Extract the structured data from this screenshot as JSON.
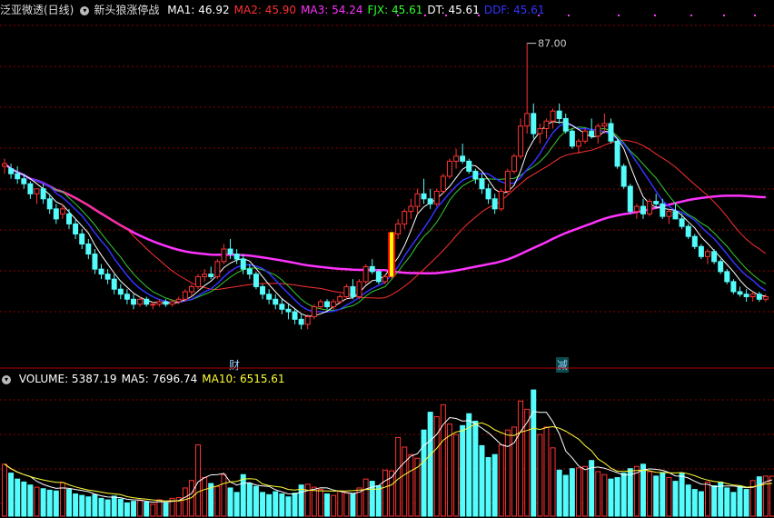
{
  "header": {
    "stock_name": "泛亚微透(日线)",
    "indicator_name": "新头狼涨停战",
    "items": [
      {
        "label": "MA1: 46.92",
        "color": "#ffffff"
      },
      {
        "label": "MA2: 45.90",
        "color": "#ff3030"
      },
      {
        "label": "MA3: 54.24",
        "color": "#ff33ff"
      },
      {
        "label": "FJX: 45.61",
        "color": "#33ff33"
      },
      {
        "label": "DT: 45.61",
        "color": "#ffffff"
      },
      {
        "label": "DDF: 45.61",
        "color": "#3333ff"
      }
    ]
  },
  "volume_header": {
    "items": [
      {
        "label": "VOLUME: 5387.19",
        "color": "#ffffff"
      },
      {
        "label": "MA5: 7696.74",
        "color": "#ffffff"
      },
      {
        "label": "MA10: 6515.61",
        "color": "#ffff33"
      }
    ]
  },
  "annotations": {
    "peak_label": "87.00",
    "marker_cai": "财",
    "marker_jian": "减"
  },
  "colors": {
    "up": "#ff3232",
    "down": "#54fcfc",
    "ma_white": "#ffffff",
    "ma_red": "#ff3030",
    "ma_magenta": "#ff33ff",
    "ma_green": "#33cc33",
    "ma_blue": "#3333ff",
    "vol_ma10": "#ffff33",
    "grid": "#8b0000",
    "signal": "#ffff00"
  },
  "chart_data": [
    {
      "type": "candlestick",
      "title": "泛亚微透(日线)",
      "candles": [
        [
          62.5,
          64,
          61,
          63
        ],
        [
          62,
          63,
          60,
          61
        ],
        [
          61,
          62.5,
          59,
          60
        ],
        [
          60,
          61,
          58,
          59
        ],
        [
          59,
          59.5,
          56,
          57
        ],
        [
          57,
          58,
          55,
          58
        ],
        [
          58,
          59,
          55,
          56
        ],
        [
          56,
          57,
          53,
          54
        ],
        [
          54,
          55,
          51,
          52
        ],
        [
          53,
          55,
          52,
          54
        ],
        [
          53,
          54,
          50,
          51
        ],
        [
          51,
          52,
          48,
          49
        ],
        [
          49,
          50,
          46,
          47
        ],
        [
          47,
          48,
          44,
          45
        ],
        [
          45,
          46,
          41,
          42
        ],
        [
          42,
          43,
          40,
          41
        ],
        [
          41,
          42,
          39,
          40
        ],
        [
          40,
          41,
          37,
          38
        ],
        [
          38,
          39,
          36,
          37
        ],
        [
          37,
          38,
          35,
          36
        ],
        [
          36,
          37,
          34,
          35
        ],
        [
          35,
          36.5,
          34.5,
          36
        ],
        [
          36,
          36.5,
          34.5,
          35
        ],
        [
          35,
          35.5,
          34,
          35
        ],
        [
          35,
          36,
          34.5,
          35.5
        ],
        [
          35.5,
          36,
          34.5,
          35
        ],
        [
          35,
          36,
          34.5,
          35.5
        ],
        [
          35.5,
          36.5,
          35,
          36
        ],
        [
          36,
          38,
          35.5,
          37.5
        ],
        [
          37.5,
          39,
          36.5,
          38.5
        ],
        [
          38.5,
          41,
          38,
          40.5
        ],
        [
          40.5,
          42,
          39.5,
          41
        ],
        [
          41,
          42.5,
          40,
          40.5
        ],
        [
          40.5,
          44,
          40,
          43.5
        ],
        [
          43.5,
          47,
          43,
          46
        ],
        [
          46,
          48,
          44,
          45
        ],
        [
          45,
          46,
          43,
          44
        ],
        [
          44,
          45,
          41,
          42
        ],
        [
          42,
          43,
          40,
          41
        ],
        [
          41,
          41.5,
          38,
          38.5
        ],
        [
          38.5,
          39,
          36,
          37
        ],
        [
          37,
          38,
          35,
          36
        ],
        [
          36,
          37,
          34,
          35
        ],
        [
          35,
          36,
          33,
          34
        ],
        [
          34,
          35,
          32,
          33.5
        ],
        [
          33.5,
          34,
          31,
          32
        ],
        [
          32,
          33,
          30,
          31
        ],
        [
          31,
          33,
          30,
          32.5
        ],
        [
          32.5,
          35,
          32,
          34.5
        ],
        [
          34.5,
          36,
          34,
          35.5
        ],
        [
          35.5,
          36,
          34,
          34.5
        ],
        [
          34.5,
          36,
          34,
          35.5
        ],
        [
          35.5,
          37,
          35,
          36.5
        ],
        [
          36.5,
          39,
          36,
          38.5
        ],
        [
          38.5,
          40,
          36,
          36.5
        ],
        [
          36.5,
          40,
          36,
          39.5
        ],
        [
          39.5,
          43,
          39,
          42.5
        ],
        [
          42.5,
          44,
          41,
          41.5
        ],
        [
          41.5,
          42,
          39,
          39.5
        ],
        [
          39.5,
          41,
          39,
          40.5
        ],
        [
          40.5,
          49,
          40,
          49
        ],
        [
          49,
          52,
          48,
          51
        ],
        [
          51,
          54,
          50,
          53.5
        ],
        [
          53.5,
          56,
          52,
          54.5
        ],
        [
          54.5,
          58,
          53,
          57
        ],
        [
          57,
          60,
          55,
          56
        ],
        [
          56,
          58,
          54,
          55
        ],
        [
          55,
          58,
          54.5,
          57.5
        ],
        [
          57.5,
          61,
          57,
          60.5
        ],
        [
          60.5,
          64,
          60,
          63.5
        ],
        [
          63.5,
          66,
          62,
          64.5
        ],
        [
          64.5,
          67,
          63,
          63.5
        ],
        [
          63.5,
          64,
          61,
          61.5
        ],
        [
          61.5,
          62,
          59,
          60
        ],
        [
          60,
          61,
          57,
          58
        ],
        [
          58,
          59,
          55,
          56
        ],
        [
          56,
          57,
          53,
          54
        ],
        [
          54,
          58,
          53.5,
          57.5
        ],
        [
          57.5,
          62,
          57,
          61.5
        ],
        [
          61.5,
          65,
          61,
          64.5
        ],
        [
          64.5,
          72,
          64,
          70.5
        ],
        [
          70.5,
          87,
          69,
          73
        ],
        [
          73,
          75,
          68,
          69
        ],
        [
          69,
          71,
          67,
          70
        ],
        [
          70,
          72,
          68,
          71.5
        ],
        [
          71.5,
          74,
          70,
          73.5
        ],
        [
          73.5,
          75,
          71,
          72
        ],
        [
          72,
          73,
          69,
          69.5
        ],
        [
          69.5,
          70,
          66,
          66.5
        ],
        [
          66.5,
          68,
          65,
          67.5
        ],
        [
          67.5,
          70,
          67,
          69.5
        ],
        [
          69.5,
          72,
          68,
          68.5
        ],
        [
          68.5,
          71,
          67,
          70.5
        ],
        [
          70.5,
          73,
          69,
          71
        ],
        [
          71,
          72,
          67,
          67.5
        ],
        [
          67.5,
          68,
          62,
          62.5
        ],
        [
          62.5,
          63,
          58,
          58.5
        ],
        [
          58.5,
          59,
          53,
          53.5
        ],
        [
          53.5,
          55,
          52,
          54.5
        ],
        [
          54.5,
          56,
          52,
          53
        ],
        [
          53,
          56,
          52.5,
          55.5
        ],
        [
          55.5,
          57,
          54,
          55
        ],
        [
          55,
          56,
          52,
          52.5
        ],
        [
          52.5,
          54,
          51,
          53.5
        ],
        [
          53.5,
          55,
          52,
          52
        ],
        [
          52,
          53,
          50,
          50.5
        ],
        [
          50.5,
          51,
          48,
          48.5
        ],
        [
          48.5,
          49,
          46,
          46.5
        ],
        [
          46.5,
          47,
          44,
          44.5
        ],
        [
          44.5,
          46,
          43,
          45.5
        ],
        [
          45.5,
          46,
          43,
          43.5
        ],
        [
          43.5,
          44,
          41,
          41.5
        ],
        [
          41.5,
          42,
          39,
          39.5
        ],
        [
          39.5,
          40,
          37,
          37.5
        ],
        [
          37.5,
          38.5,
          36.5,
          37
        ],
        [
          37,
          38,
          35.5,
          36.5
        ],
        [
          36.5,
          37.5,
          35.5,
          37
        ],
        [
          37,
          37.5,
          35.5,
          36
        ],
        [
          36,
          37,
          35.5,
          36.5
        ]
      ],
      "series": [
        {
          "name": "MA1",
          "values": []
        },
        {
          "name": "MA2",
          "values": []
        },
        {
          "name": "MA3",
          "values": []
        },
        {
          "name": "FJX",
          "values": []
        },
        {
          "name": "DDF",
          "values": []
        }
      ],
      "peak_label": 87.0,
      "ylim": [
        25,
        92
      ]
    },
    {
      "type": "bar",
      "title": "VOLUME",
      "values": [
        7000,
        5800,
        5000,
        4600,
        4200,
        3900,
        3700,
        3500,
        3400,
        4500,
        3600,
        3000,
        2800,
        2600,
        2900,
        2400,
        2200,
        2700,
        2300,
        1800,
        2000,
        2100,
        1900,
        1600,
        2200,
        1800,
        2400,
        2500,
        3800,
        4800,
        9600,
        5200,
        4400,
        4000,
        5600,
        3800,
        3200,
        5600,
        4400,
        4000,
        3200,
        2900,
        3300,
        3000,
        2600,
        3100,
        4200,
        4300,
        3900,
        3600,
        3000,
        2800,
        3400,
        3100,
        3000,
        3800,
        5000,
        4700,
        4100,
        6200,
        6100,
        10600,
        9300,
        8300,
        7800,
        11600,
        14000,
        13400,
        15000,
        12400,
        11000,
        12200,
        13800,
        12800,
        9500,
        7900,
        8300,
        9600,
        11600,
        12000,
        15500,
        14400,
        17000,
        11000,
        12000,
        9200,
        6200,
        5500,
        6400,
        6500,
        6700,
        7500,
        6000,
        5600,
        5000,
        5200,
        5800,
        6400,
        6700,
        7000,
        6000,
        5400,
        5800,
        5200,
        4700,
        5800,
        4200,
        3600,
        3300,
        4600,
        4100,
        4600,
        3800,
        3200,
        4000,
        3600,
        4800,
        5300,
        5400,
        5387.19
      ],
      "series": [
        {
          "name": "MA5",
          "values": []
        },
        {
          "name": "MA10",
          "values": []
        }
      ]
    }
  ]
}
